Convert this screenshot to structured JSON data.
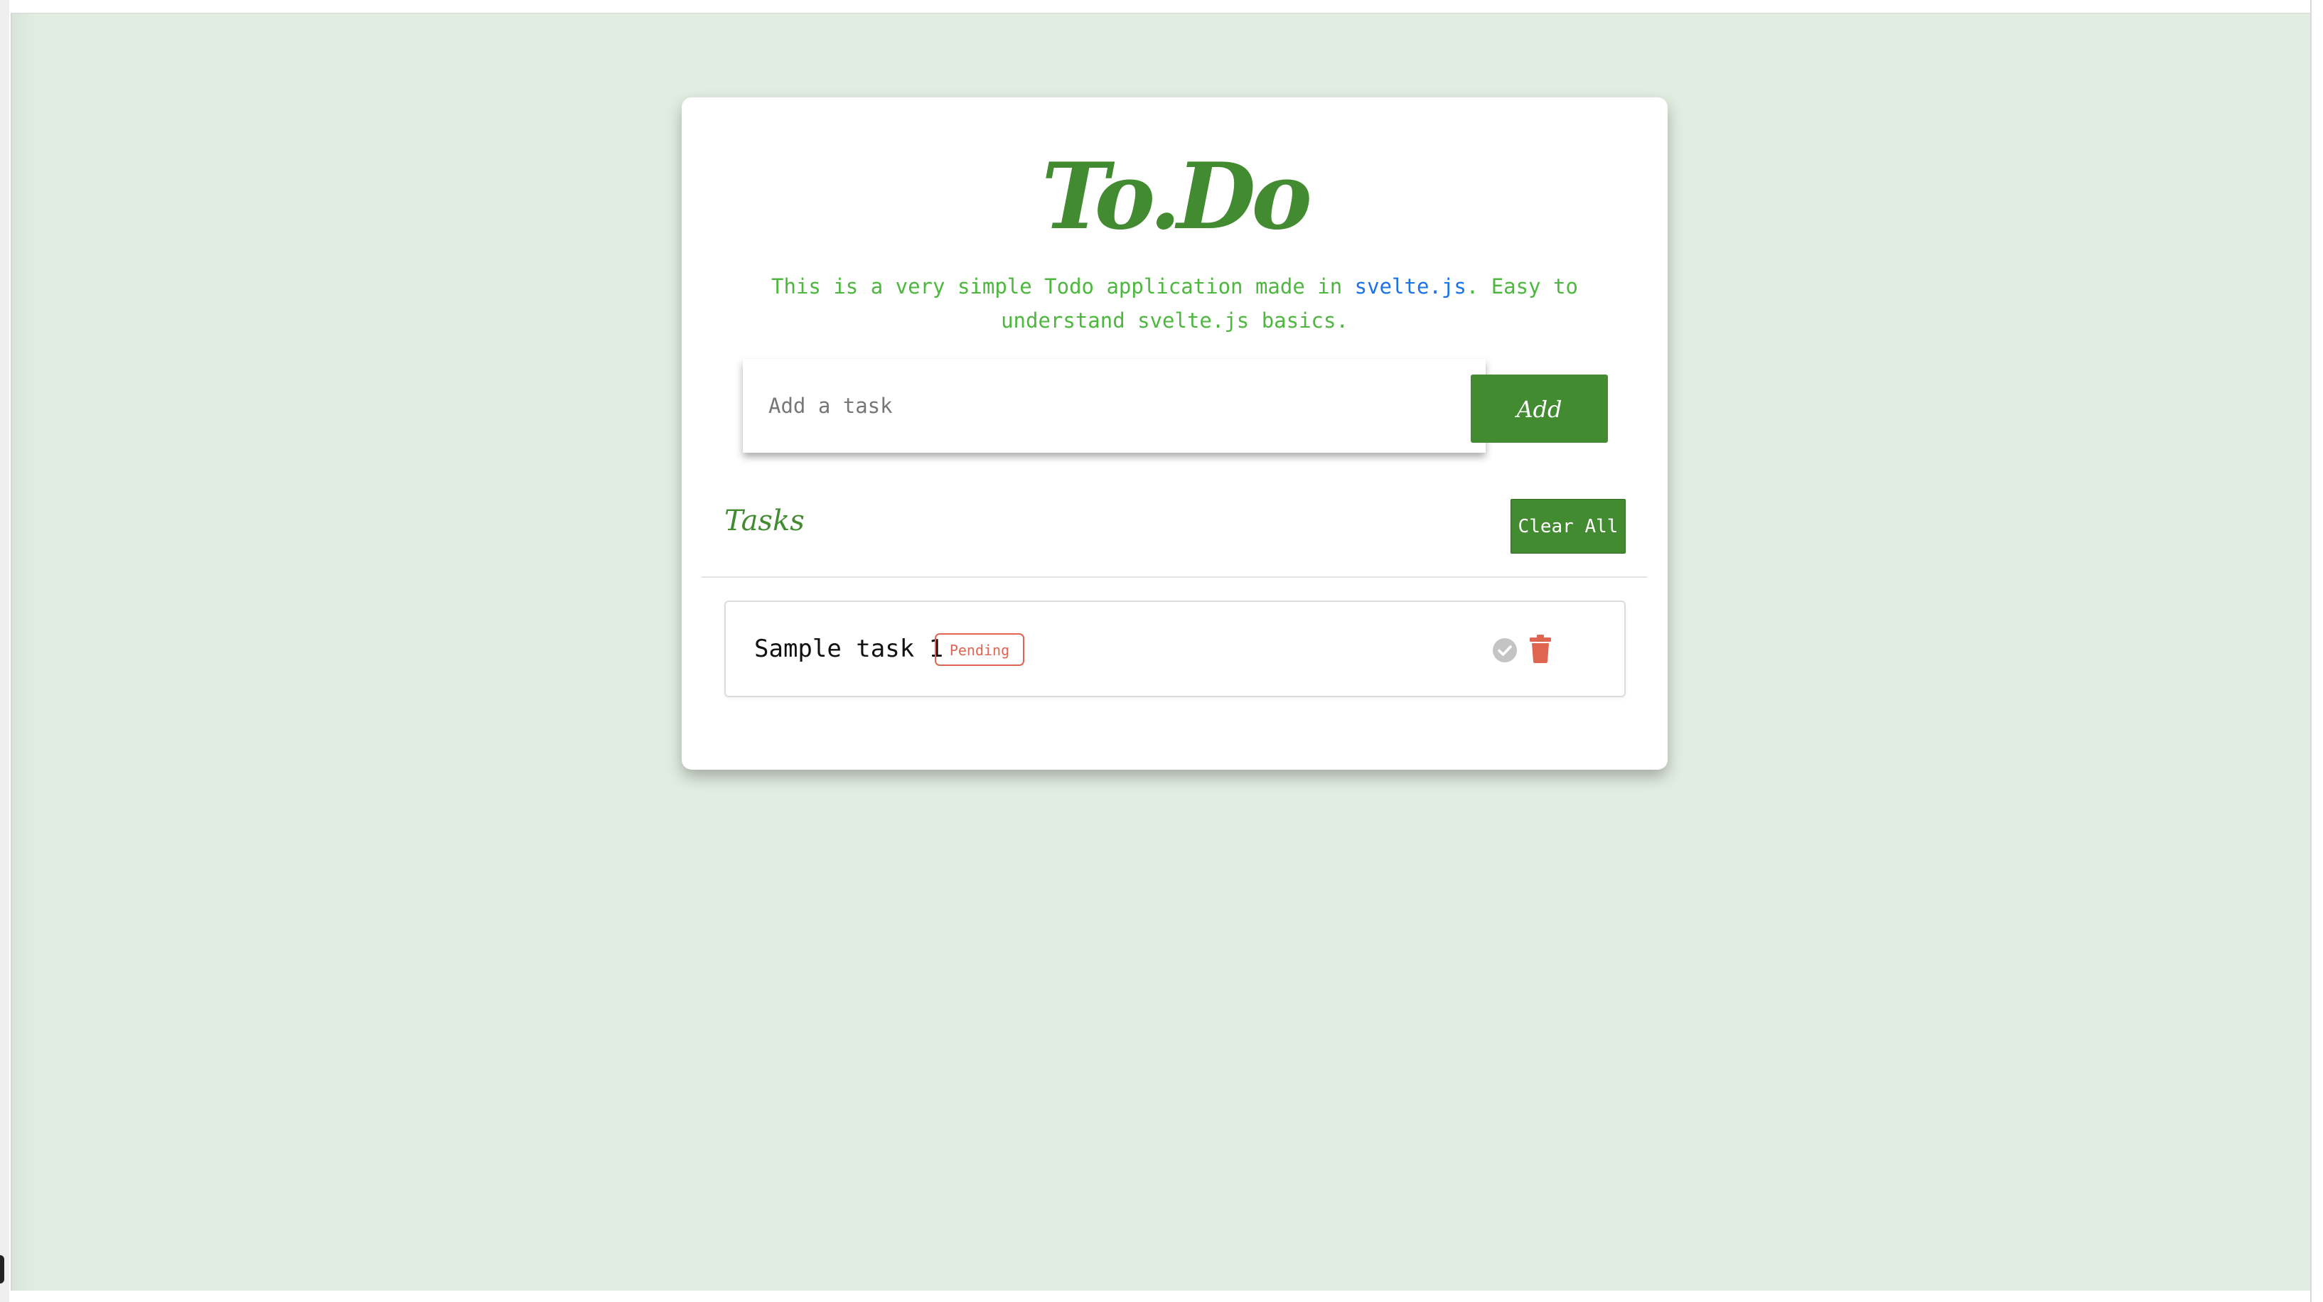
{
  "app": {
    "title": "To.Do",
    "intro_before_link": "This is a very simple Todo application made in ",
    "intro_link": "svelte.js",
    "intro_after_link": ". Easy to understand svelte.js basics."
  },
  "input": {
    "placeholder": "Add a task",
    "value": ""
  },
  "add_button": {
    "label": "Add"
  },
  "tasks_section": {
    "heading": "Tasks",
    "clear_all_label": "Clear All"
  },
  "tasks": [
    {
      "text": "Sample task 1",
      "status": "Pending",
      "complete_icon": "check-circle-icon",
      "delete_icon": "trash-icon"
    }
  ],
  "colors": {
    "background": "#e2ede1",
    "primary": "#428b31",
    "intro_text": "#4cb83d",
    "link": "#1a73e8",
    "pending": "#e06550",
    "complete_icon": "#c4c4c4"
  }
}
